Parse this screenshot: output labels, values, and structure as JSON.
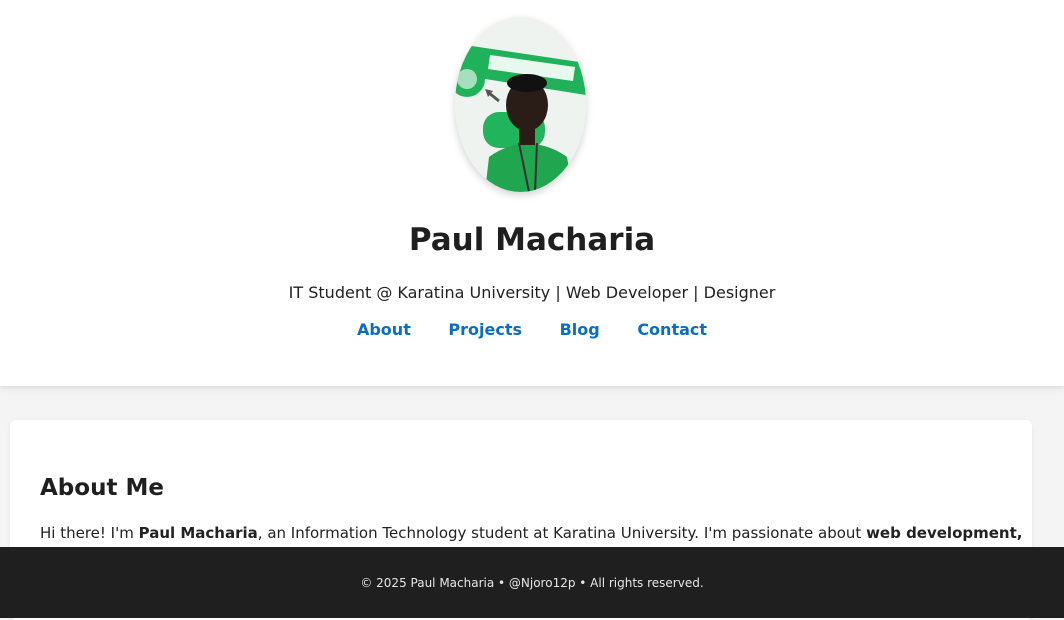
{
  "profile": {
    "name": "Paul Macharia",
    "tagline": "IT Student @ Karatina University | Web Developer | Designer",
    "avatar_icon": "profile-photo"
  },
  "nav": {
    "items": [
      {
        "label": "About"
      },
      {
        "label": "Projects"
      },
      {
        "label": "Blog"
      },
      {
        "label": "Contact"
      }
    ],
    "link_color": "#0a6fc4"
  },
  "about": {
    "heading": "About Me",
    "text_before": "Hi there! I'm ",
    "name_bold": "Paul Macharia",
    "text_middle": ", an Information Technology student at Karatina University. I'm passionate about ",
    "text_bold_end": "web development,"
  },
  "footer": {
    "text": "© 2025 Paul Macharia • @Njoro12p • All rights reserved."
  },
  "colors": {
    "footer_bg": "#1f1f1f",
    "page_bg": "#f4f4f4"
  }
}
